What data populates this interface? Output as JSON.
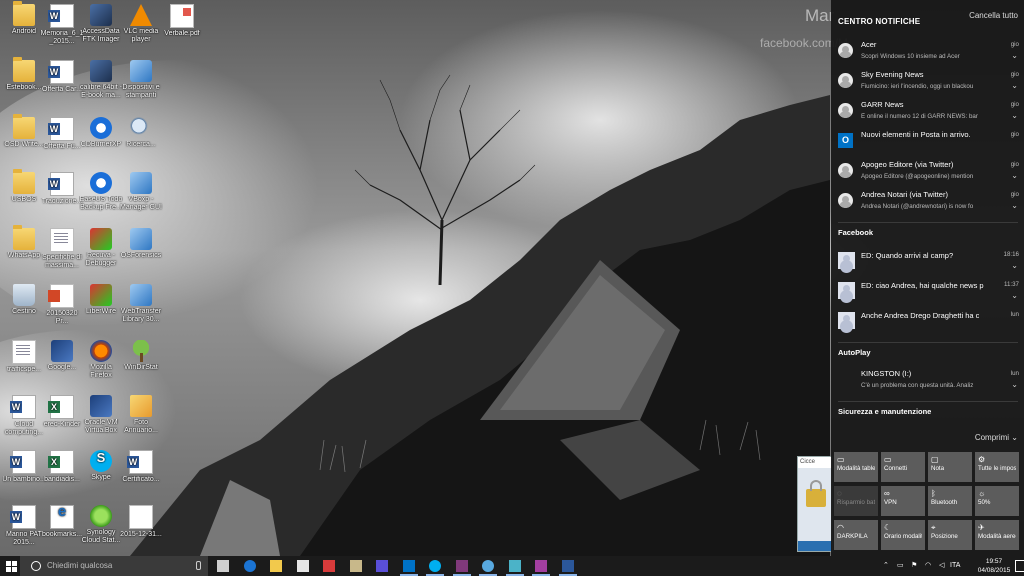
{
  "wallpaper": {
    "name_text": "Mar",
    "url_text": "facebook.com/M"
  },
  "desktop_icons": [
    {
      "label": "Android",
      "icon": "folder-icon",
      "cls": "i-folder"
    },
    {
      "label": "Memoria_6_1_2015...",
      "icon": "word-doc-icon",
      "cls": "i-word"
    },
    {
      "label": "AccessData FTK Imager",
      "icon": "ftk-imager-icon",
      "cls": "i-app1"
    },
    {
      "label": "VLC media player",
      "icon": "vlc-icon",
      "cls": "i-vlc"
    },
    {
      "label": "Verbale.pdf",
      "icon": "pdf-icon",
      "cls": "i-pdf"
    },
    {
      "label": "Estebook...",
      "icon": "folder-icon",
      "cls": "i-folder"
    },
    {
      "label": "Offerta Car...",
      "icon": "word-doc-icon",
      "cls": "i-word"
    },
    {
      "label": "calibre 64bit - E-book ma...",
      "icon": "calibre-icon",
      "cls": "i-app1"
    },
    {
      "label": "Dispositivi e stampanti",
      "icon": "devices-printers-icon",
      "cls": "i-app2"
    },
    {
      "label": "OSD Write...",
      "icon": "folder-icon",
      "cls": "i-folder"
    },
    {
      "label": "Offerta Fu...",
      "icon": "word-doc-icon",
      "cls": "i-word"
    },
    {
      "label": "CDBurnerXP",
      "icon": "cdburner-icon",
      "cls": "i-app3"
    },
    {
      "label": "Ricerca...",
      "icon": "search-file-icon",
      "cls": "i-mag"
    },
    {
      "label": "USBOS",
      "icon": "folder-icon",
      "cls": "i-folder"
    },
    {
      "label": "Traduzione...",
      "icon": "word-doc-icon",
      "cls": "i-word"
    },
    {
      "label": "EaseUS Todo Backup Fre...",
      "icon": "easeus-icon",
      "cls": "i-app3"
    },
    {
      "label": "VBoxp - Manager GUI",
      "icon": "vbox-manager-icon",
      "cls": "i-app2"
    },
    {
      "label": "WhatsApp",
      "icon": "folder-icon",
      "cls": "i-folder"
    },
    {
      "label": "Specifiche di massima...",
      "icon": "word-doc-icon",
      "cls": "i-doc"
    },
    {
      "label": "Recuva - Debugger",
      "icon": "recuva-icon",
      "cls": "i-app4"
    },
    {
      "label": "OSForensics",
      "icon": "osforensics-icon",
      "cls": "i-app2"
    },
    {
      "label": "Cestino",
      "icon": "recycle-bin-icon",
      "cls": "i-recycle"
    },
    {
      "label": "20150320 Pr...",
      "icon": "ppt-icon",
      "cls": "i-ppt"
    },
    {
      "label": "LiberWire",
      "icon": "liberwire-icon",
      "cls": "i-app4"
    },
    {
      "label": "WebTransfer Library 30...",
      "icon": "webtransfer-icon",
      "cls": "i-app2"
    },
    {
      "label": "trafficspe...",
      "icon": "document-icon",
      "cls": "i-doc"
    },
    {
      "label": "Google...",
      "icon": "color-image-icon",
      "cls": "i-app7"
    },
    {
      "label": "Mozilla Firefox",
      "icon": "firefox-icon",
      "cls": "i-app5"
    },
    {
      "label": "WinDirStat",
      "icon": "windirstat-icon",
      "cls": "i-tree"
    },
    {
      "label": "Cloud computing...",
      "icon": "word-doc-icon",
      "cls": "i-word"
    },
    {
      "label": "ered-Kinder",
      "icon": "excel-icon",
      "cls": "i-excel"
    },
    {
      "label": "Oracle VM VirtualBox",
      "icon": "virtualbox-icon",
      "cls": "i-app7"
    },
    {
      "label": "Foto Annuario...",
      "icon": "photos-icon",
      "cls": "i-files"
    },
    {
      "label": "Un bambino...",
      "icon": "word-doc-icon",
      "cls": "i-word"
    },
    {
      "label": "bandiadis...",
      "icon": "excel-icon",
      "cls": "i-excel"
    },
    {
      "label": "Skype",
      "icon": "skype-icon",
      "cls": "i-skype"
    },
    {
      "label": "Certificato...",
      "icon": "word-doc-icon",
      "cls": "i-word"
    },
    {
      "label": "Marino PAT 2015...",
      "icon": "word-doc-icon",
      "cls": "i-word"
    },
    {
      "label": "bookmarks...",
      "icon": "edge-file-icon",
      "cls": "i-edge"
    },
    {
      "label": "Synology Cloud Stat...",
      "icon": "synology-icon",
      "cls": "i-sync"
    },
    {
      "label": "2015-12-31...",
      "icon": "blank-file-icon",
      "cls": "i-blank"
    }
  ],
  "action_center": {
    "title": "CENTRO NOTIFICHE",
    "clear_all": "Cancella tutto",
    "notifications": [
      {
        "title": "Acer",
        "body": "Scopri Windows 10 insieme ad Acer",
        "time": "gio",
        "icon": "acer-avatar-icon"
      },
      {
        "title": "Sky Evening News",
        "body": "Fiumicino: ieri l'incendio, oggi un blackou",
        "time": "gio",
        "icon": "sky-avatar-icon"
      },
      {
        "title": "GARR News",
        "body": "È online il numero 12 di GARR NEWS: bar",
        "time": "gio",
        "icon": "garr-avatar-icon"
      },
      {
        "title": "Nuovi elementi in Posta in arrivo.",
        "body": "",
        "time": "gio",
        "icon": "outlook-icon"
      },
      {
        "title": "Apogeo Editore (via Twitter)",
        "body": "Apogeo Editore (@apogeonline) mention",
        "time": "gio",
        "icon": "apogeo-avatar-icon"
      },
      {
        "title": "Andrea Notari (via Twitter)",
        "body": "Andrea Notari (@andrewnotari) is now fo",
        "time": "gio",
        "icon": "notari-avatar-icon"
      }
    ],
    "facebook": {
      "heading": "Facebook",
      "items": [
        {
          "text": "ED: Quando arrivi al camp?",
          "time": "18:16"
        },
        {
          "text": "ED: ciao Andrea, hai qualche news p",
          "time": "11:37"
        },
        {
          "text": "Anche Andrea Drego Draghetti ha c",
          "time": "lun"
        }
      ]
    },
    "autoplay": {
      "heading": "AutoPlay",
      "title": "KINGSTON (I:)",
      "body": "C'è un problema con questa unità. Analiz",
      "time": "lun"
    },
    "security_heading": "Sicurezza e manutenzione",
    "collapse_label": "Comprimi",
    "quick_actions": [
      {
        "label": "Modalità tablet",
        "icon": "tablet-mode-icon",
        "glyph": "▭",
        "state": "on"
      },
      {
        "label": "Connetti",
        "icon": "connect-icon",
        "glyph": "▭",
        "state": "on"
      },
      {
        "label": "Nota",
        "icon": "note-icon",
        "glyph": "▢",
        "state": "on"
      },
      {
        "label": "Tutte le impostazioni",
        "icon": "settings-icon",
        "glyph": "⚙",
        "state": "on"
      },
      {
        "label": "Risparmio batteria",
        "icon": "battery-saver-icon",
        "glyph": "◌",
        "state": "off"
      },
      {
        "label": "VPN",
        "icon": "vpn-icon",
        "glyph": "∞",
        "state": "on"
      },
      {
        "label": "Bluetooth",
        "icon": "bluetooth-icon",
        "glyph": "ᛒ",
        "state": "on"
      },
      {
        "label": "50%",
        "icon": "brightness-icon",
        "glyph": "☼",
        "state": "on"
      },
      {
        "label": "DARKPILA",
        "icon": "wifi-icon",
        "glyph": "◠",
        "state": "on"
      },
      {
        "label": "Orario modalità non",
        "icon": "quiet-hours-icon",
        "glyph": "☾",
        "state": "on"
      },
      {
        "label": "Posizione",
        "icon": "location-icon",
        "glyph": "⌖",
        "state": "on"
      },
      {
        "label": "Modalità aereo",
        "icon": "airplane-icon",
        "glyph": "✈",
        "state": "on"
      }
    ]
  },
  "popup": {
    "title": "Cicce"
  },
  "taskbar": {
    "search_placeholder": "Chiedimi qualcosa",
    "apps": [
      {
        "icon": "task-view-icon",
        "color": "#cfcfcf"
      },
      {
        "icon": "edge-icon",
        "color": "#1b74d3"
      },
      {
        "icon": "file-explorer-icon",
        "color": "#f2c94c"
      },
      {
        "icon": "store-icon",
        "color": "#e6e6e6"
      },
      {
        "icon": "app-red-icon",
        "color": "#d83b3b"
      },
      {
        "icon": "app-notepad-icon",
        "color": "#c8b88a"
      },
      {
        "icon": "app-blue-icon",
        "color": "#5a4fd8"
      },
      {
        "icon": "outlook-taskbar-icon",
        "color": "#0072c6"
      },
      {
        "icon": "skype-taskbar-icon",
        "color": "#00aff0"
      },
      {
        "icon": "onenote-icon",
        "color": "#80397b"
      },
      {
        "icon": "app-globe-icon",
        "color": "#58a9e0"
      },
      {
        "icon": "app-cube-icon",
        "color": "#4bb3c8"
      },
      {
        "icon": "onenote2-icon",
        "color": "#a33fa0"
      },
      {
        "icon": "word-taskbar-icon",
        "color": "#2b579a"
      }
    ],
    "language": "ITA",
    "time": "19:57",
    "date": "04/08/2015"
  }
}
